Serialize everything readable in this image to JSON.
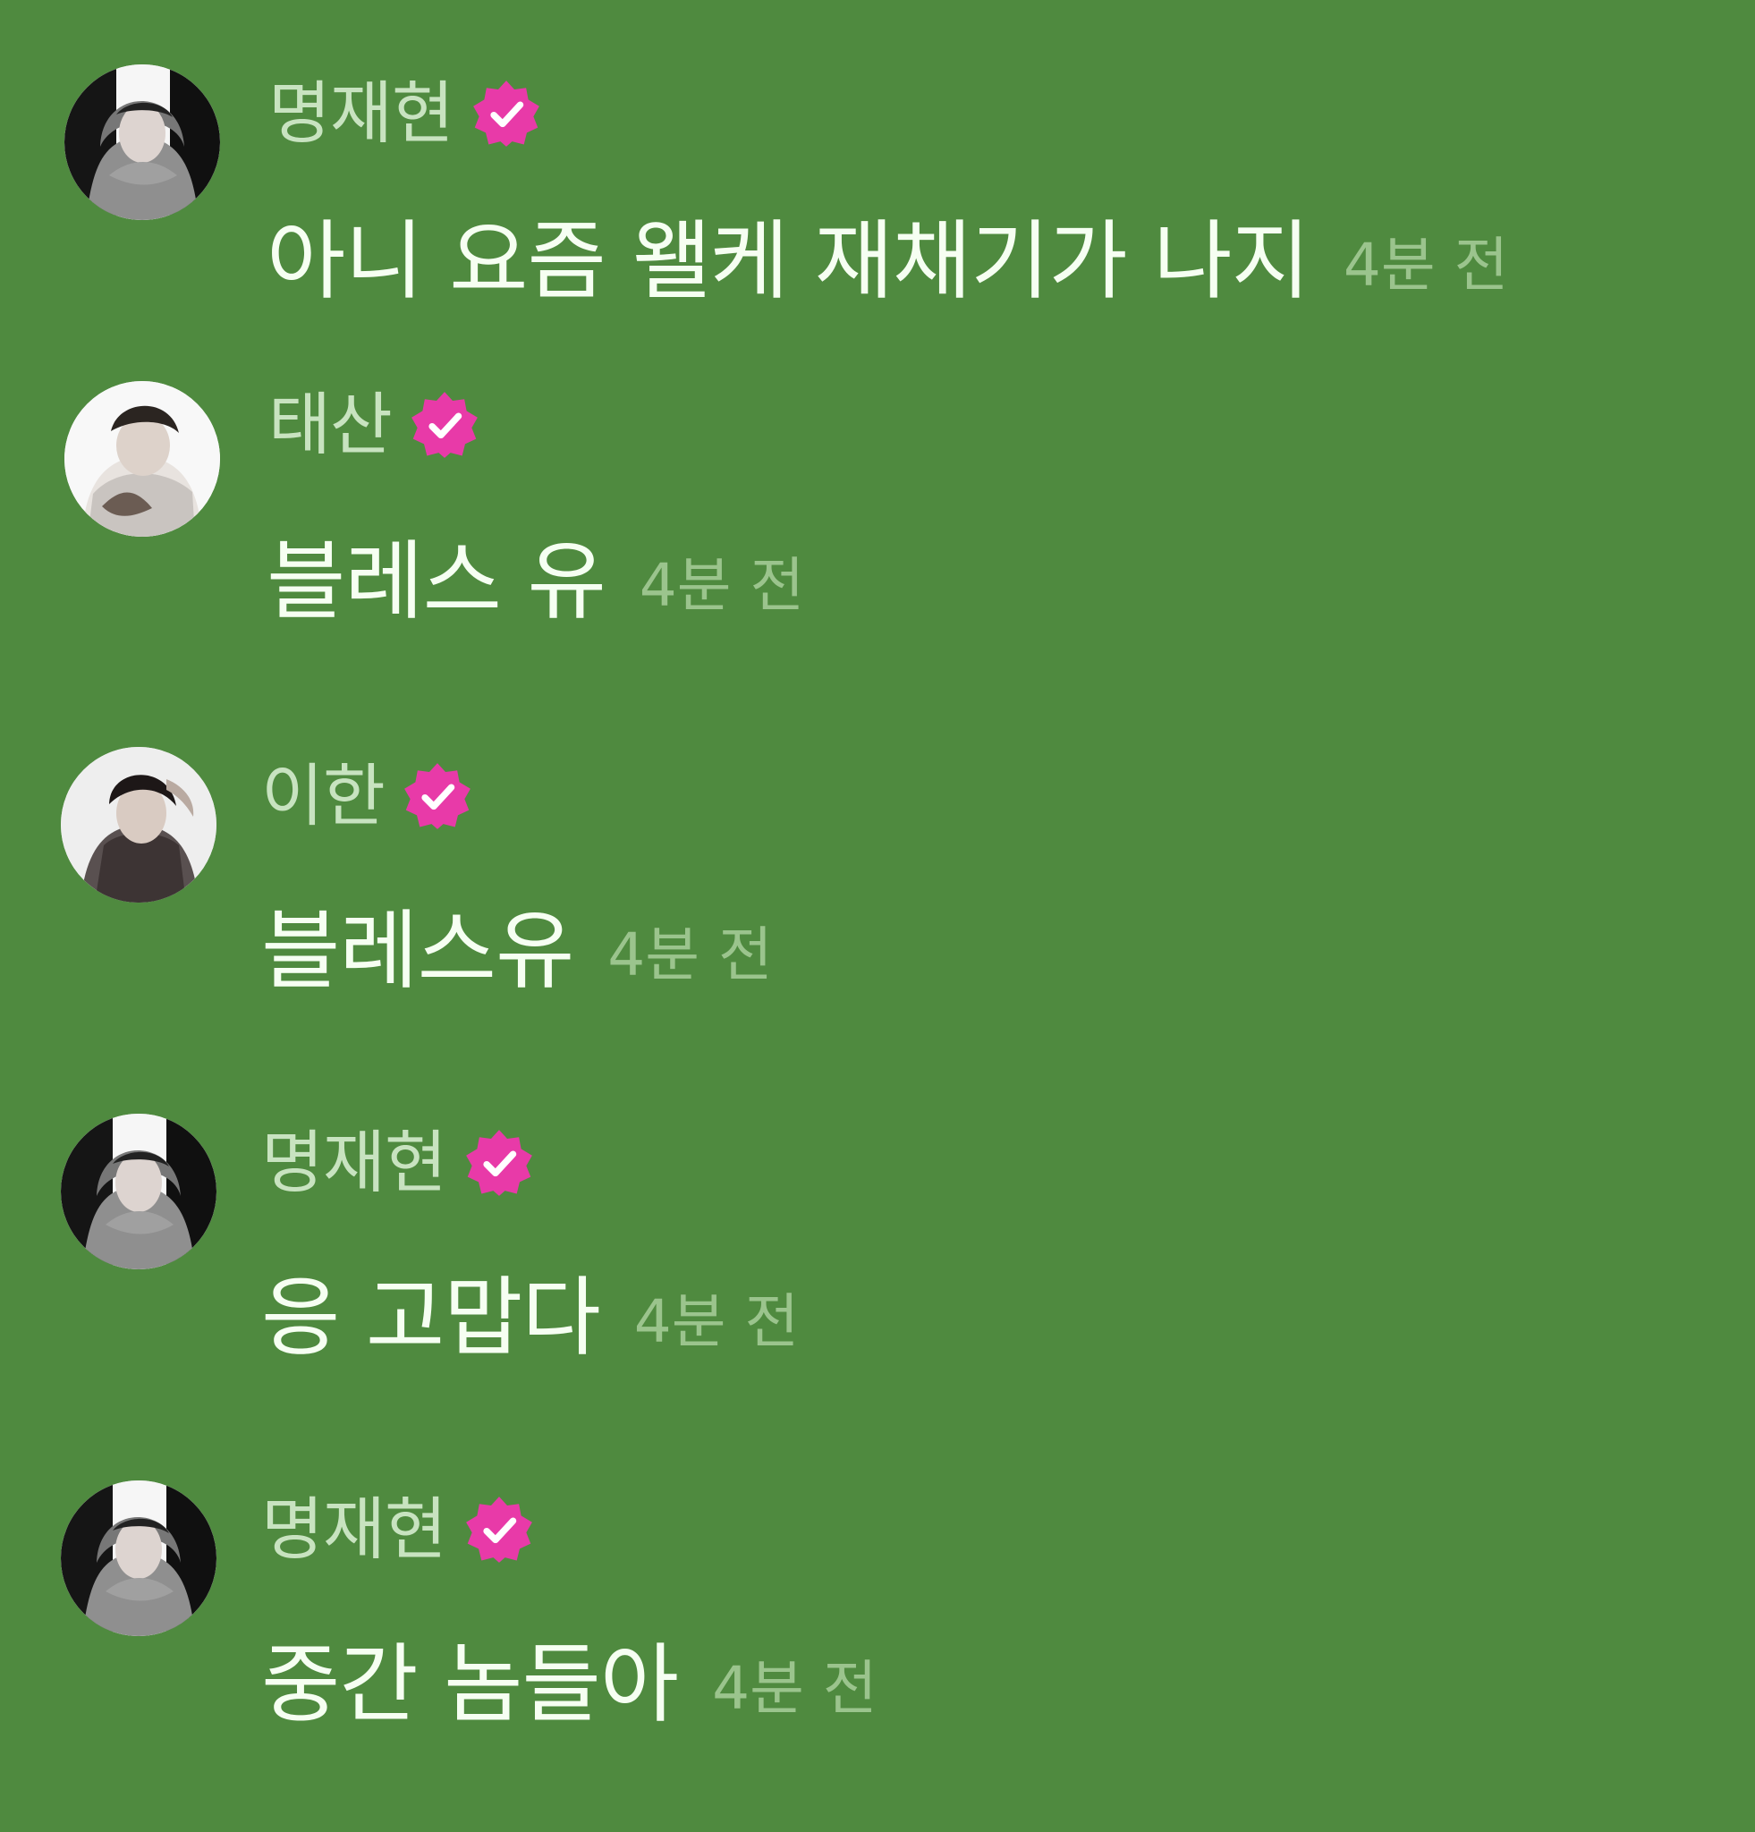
{
  "comments": [
    {
      "author": "명재현",
      "verified_badge_icon": "verified-check-badge-icon",
      "message": "아니 요즘 왤케 재채기가 나지",
      "time": "4분 전"
    },
    {
      "author": "태산",
      "verified_badge_icon": "verified-check-badge-icon",
      "message": "블레스 유",
      "time": "4분 전"
    },
    {
      "author": "이한",
      "verified_badge_icon": "verified-check-badge-icon",
      "message": "블레스유",
      "time": "4분 전"
    },
    {
      "author": "명재현",
      "verified_badge_icon": "verified-check-badge-icon",
      "message": "응 고맙다",
      "time": "4분 전"
    },
    {
      "author": "명재현",
      "verified_badge_icon": "verified-check-badge-icon",
      "message": "중간 놈들아",
      "time": "4분 전"
    }
  ],
  "colors": {
    "background": "#4f8a3f",
    "author": "#c8e3c0",
    "message": "#f6fff2",
    "time": "#9bc48d",
    "badge": "#e83aa8"
  }
}
